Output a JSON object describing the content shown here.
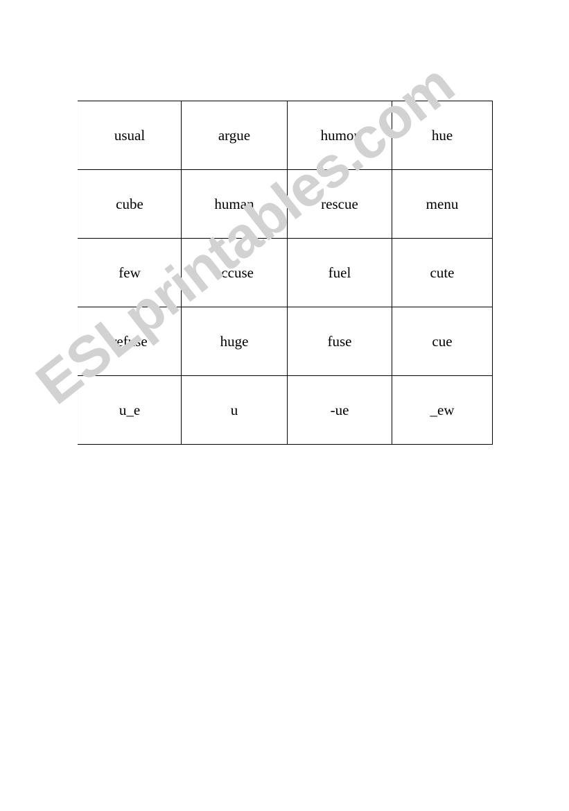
{
  "document": {
    "type": "worksheet",
    "background_color": "#ffffff",
    "text_color": "#000000",
    "border_color": "#000000"
  },
  "watermark": {
    "text": "ESLprintables.com",
    "color": "#d2d2d2",
    "rotation_degrees": -38
  },
  "table": {
    "columns": 4,
    "rows": 5,
    "cells": [
      [
        "usual",
        "argue",
        "humor",
        "hue"
      ],
      [
        "cube",
        "human",
        "rescue",
        "menu"
      ],
      [
        "few",
        "accuse",
        "fuel",
        "cute"
      ],
      [
        "refuse",
        "huge",
        "fuse",
        "cue"
      ],
      [
        "u_e",
        "u",
        "-ue",
        "_ew"
      ]
    ]
  }
}
